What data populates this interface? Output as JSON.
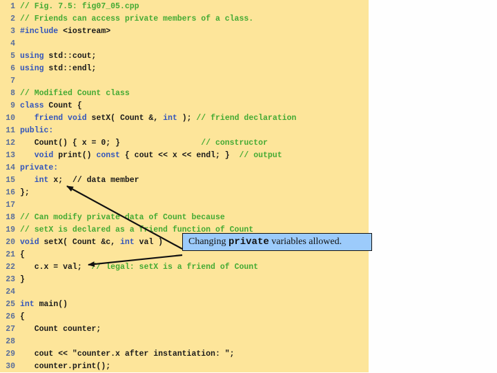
{
  "code": {
    "lines": [
      {
        "n": "1",
        "segments": [
          {
            "t": "// Fig. 7.5: fig07_05.cpp",
            "c": "cm"
          }
        ]
      },
      {
        "n": "2",
        "segments": [
          {
            "t": "// Friends can access private members of a class.",
            "c": "cm"
          }
        ]
      },
      {
        "n": "3",
        "segments": [
          {
            "t": "#include",
            "c": "kw"
          },
          {
            "t": " <iostream>",
            "c": ""
          }
        ]
      },
      {
        "n": "4",
        "segments": []
      },
      {
        "n": "5",
        "segments": [
          {
            "t": "using",
            "c": "kw"
          },
          {
            "t": " std::cout;",
            "c": ""
          }
        ]
      },
      {
        "n": "6",
        "segments": [
          {
            "t": "using",
            "c": "kw"
          },
          {
            "t": " std::endl;",
            "c": ""
          }
        ]
      },
      {
        "n": "7",
        "segments": []
      },
      {
        "n": "8",
        "segments": [
          {
            "t": "// Modified Count class",
            "c": "cm"
          }
        ]
      },
      {
        "n": "9",
        "segments": [
          {
            "t": "class",
            "c": "kw"
          },
          {
            "t": " Count {",
            "c": ""
          }
        ]
      },
      {
        "n": "10",
        "segments": [
          {
            "t": "   ",
            "c": ""
          },
          {
            "t": "friend",
            "c": "kw"
          },
          {
            "t": " ",
            "c": ""
          },
          {
            "t": "void",
            "c": "kw"
          },
          {
            "t": " setX( Count &, ",
            "c": ""
          },
          {
            "t": "int",
            "c": "kw"
          },
          {
            "t": " ); ",
            "c": ""
          },
          {
            "t": "// friend declaration",
            "c": "cm"
          }
        ]
      },
      {
        "n": "11",
        "segments": [
          {
            "t": "public:",
            "c": "kw"
          }
        ]
      },
      {
        "n": "12",
        "segments": [
          {
            "t": "   Count() { x = 0; }                 ",
            "c": ""
          },
          {
            "t": "// constructor",
            "c": "cm"
          }
        ]
      },
      {
        "n": "13",
        "segments": [
          {
            "t": "   ",
            "c": ""
          },
          {
            "t": "void",
            "c": "kw"
          },
          {
            "t": " print() ",
            "c": ""
          },
          {
            "t": "const",
            "c": "kw"
          },
          {
            "t": " { cout << x << endl; }  ",
            "c": ""
          },
          {
            "t": "// output",
            "c": "cm"
          }
        ]
      },
      {
        "n": "14",
        "segments": [
          {
            "t": "private:",
            "c": "kw"
          }
        ]
      },
      {
        "n": "15",
        "segments": [
          {
            "t": "   ",
            "c": ""
          },
          {
            "t": "int",
            "c": "kw"
          },
          {
            "t": " x;  // data member",
            "c": ""
          }
        ]
      },
      {
        "n": "16",
        "segments": [
          {
            "t": "};",
            "c": ""
          }
        ]
      },
      {
        "n": "17",
        "segments": []
      },
      {
        "n": "18",
        "segments": [
          {
            "t": "// Can modify private data of Count because",
            "c": "cm"
          }
        ]
      },
      {
        "n": "19",
        "segments": [
          {
            "t": "// setX is declared as a friend function of Count",
            "c": "cm"
          }
        ]
      },
      {
        "n": "20",
        "segments": [
          {
            "t": "void",
            "c": "kw"
          },
          {
            "t": " setX( Count &c, ",
            "c": ""
          },
          {
            "t": "int",
            "c": "kw"
          },
          {
            "t": " val )",
            "c": ""
          }
        ]
      },
      {
        "n": "21",
        "segments": [
          {
            "t": "{",
            "c": ""
          }
        ]
      },
      {
        "n": "22",
        "segments": [
          {
            "t": "   c.x = val;  ",
            "c": ""
          },
          {
            "t": "// legal: setX is a friend of Count",
            "c": "cm"
          }
        ]
      },
      {
        "n": "23",
        "segments": [
          {
            "t": "}",
            "c": ""
          }
        ]
      },
      {
        "n": "24",
        "segments": []
      },
      {
        "n": "25",
        "segments": [
          {
            "t": "int",
            "c": "kw"
          },
          {
            "t": " main()",
            "c": ""
          }
        ]
      },
      {
        "n": "26",
        "segments": [
          {
            "t": "{",
            "c": ""
          }
        ]
      },
      {
        "n": "27",
        "segments": [
          {
            "t": "   Count counter;",
            "c": ""
          }
        ]
      },
      {
        "n": "28",
        "segments": []
      },
      {
        "n": "29",
        "segments": [
          {
            "t": "   cout << \"counter.x after instantiation: \";",
            "c": ""
          }
        ]
      },
      {
        "n": "30",
        "segments": [
          {
            "t": "   counter.print();",
            "c": ""
          }
        ]
      }
    ]
  },
  "callout": {
    "before": "Changing ",
    "keyword": "private",
    "after": " variables allowed."
  },
  "colors": {
    "panel_bg": "#fde59a",
    "keyword": "#3355bb",
    "comment": "#44aa33",
    "callout_bg": "#9ccbfb"
  }
}
